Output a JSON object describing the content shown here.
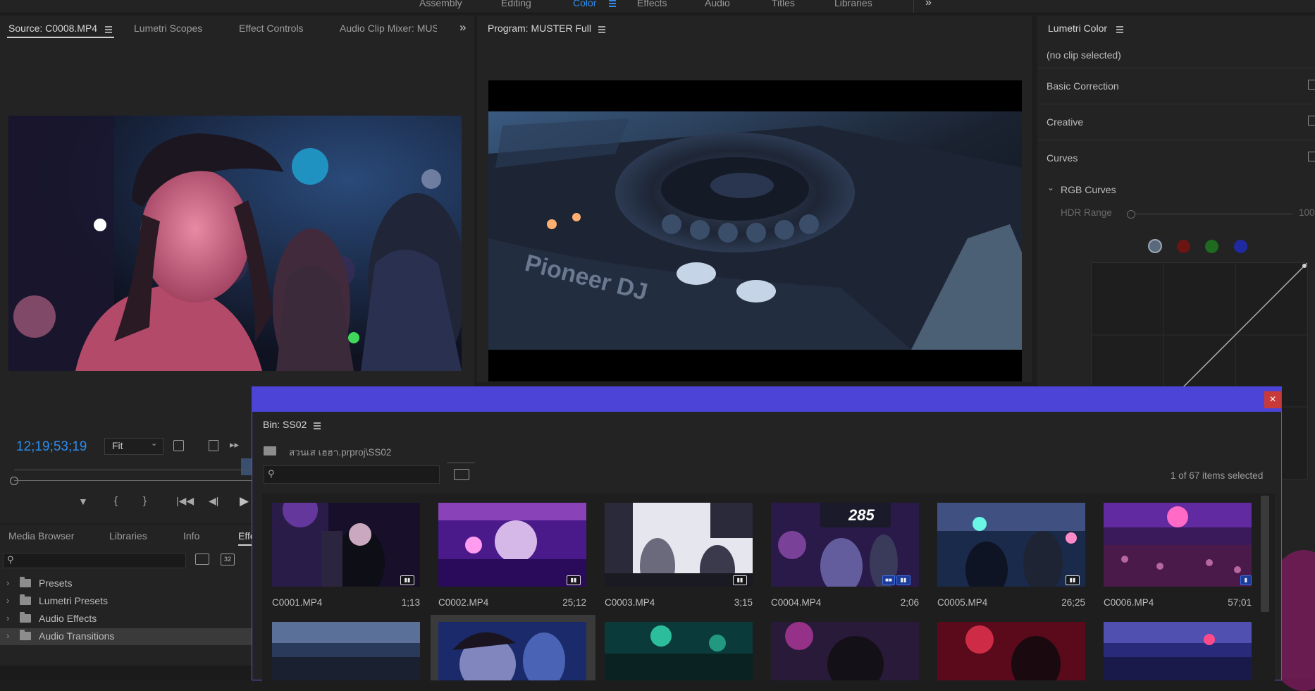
{
  "workspaces": {
    "items": [
      "Assembly",
      "Editing",
      "Color",
      "Effects",
      "Audio",
      "Titles",
      "Libraries"
    ],
    "active": "Color",
    "more": "»"
  },
  "source_panel": {
    "tabs": [
      "Source: C0008.MP4",
      "Lumetri Scopes",
      "Effect Controls",
      "Audio Clip Mixer: MUST"
    ],
    "more": "»",
    "timecode": "12;19;53;19",
    "zoom": "Fit"
  },
  "program_panel": {
    "title": "Program: MUSTER Full"
  },
  "lumetri": {
    "title": "Lumetri Color",
    "clip": "(no clip selected)",
    "sections": [
      "Basic Correction",
      "Creative",
      "Curves"
    ],
    "rgb_curves": "RGB Curves",
    "hdr_range_label": "HDR Range",
    "hdr_range_value": "100",
    "channel_colors": [
      "#9aa6b4",
      "#6b1414",
      "#1e6a1e",
      "#1f2aa0"
    ]
  },
  "effects_panel": {
    "tabs": [
      "Media Browser",
      "Libraries",
      "Info",
      "Effe"
    ],
    "items": [
      "Presets",
      "Lumetri Presets",
      "Audio Effects",
      "Audio Transitions"
    ],
    "selected": "Audio Transitions"
  },
  "bin": {
    "close": "×",
    "title": "Bin: SS02",
    "path": "สวนเส เฮฮา.prproj\\SS02",
    "search_placeholder": "",
    "selection_status": "1 of 67 items selected",
    "clips": [
      {
        "name": "C0001.MP4",
        "duration": "1;13"
      },
      {
        "name": "C0002.MP4",
        "duration": "25;12"
      },
      {
        "name": "C0003.MP4",
        "duration": "3;15"
      },
      {
        "name": "C0004.MP4",
        "duration": "2;06"
      },
      {
        "name": "C0005.MP4",
        "duration": "26;25"
      },
      {
        "name": "C0006.MP4",
        "duration": "57;01"
      }
    ],
    "thumb_text_285": "285",
    "accent": "#4b44d6"
  },
  "colors": {
    "accent_blue": "#2d8ceb",
    "panel_bg": "#232323"
  }
}
